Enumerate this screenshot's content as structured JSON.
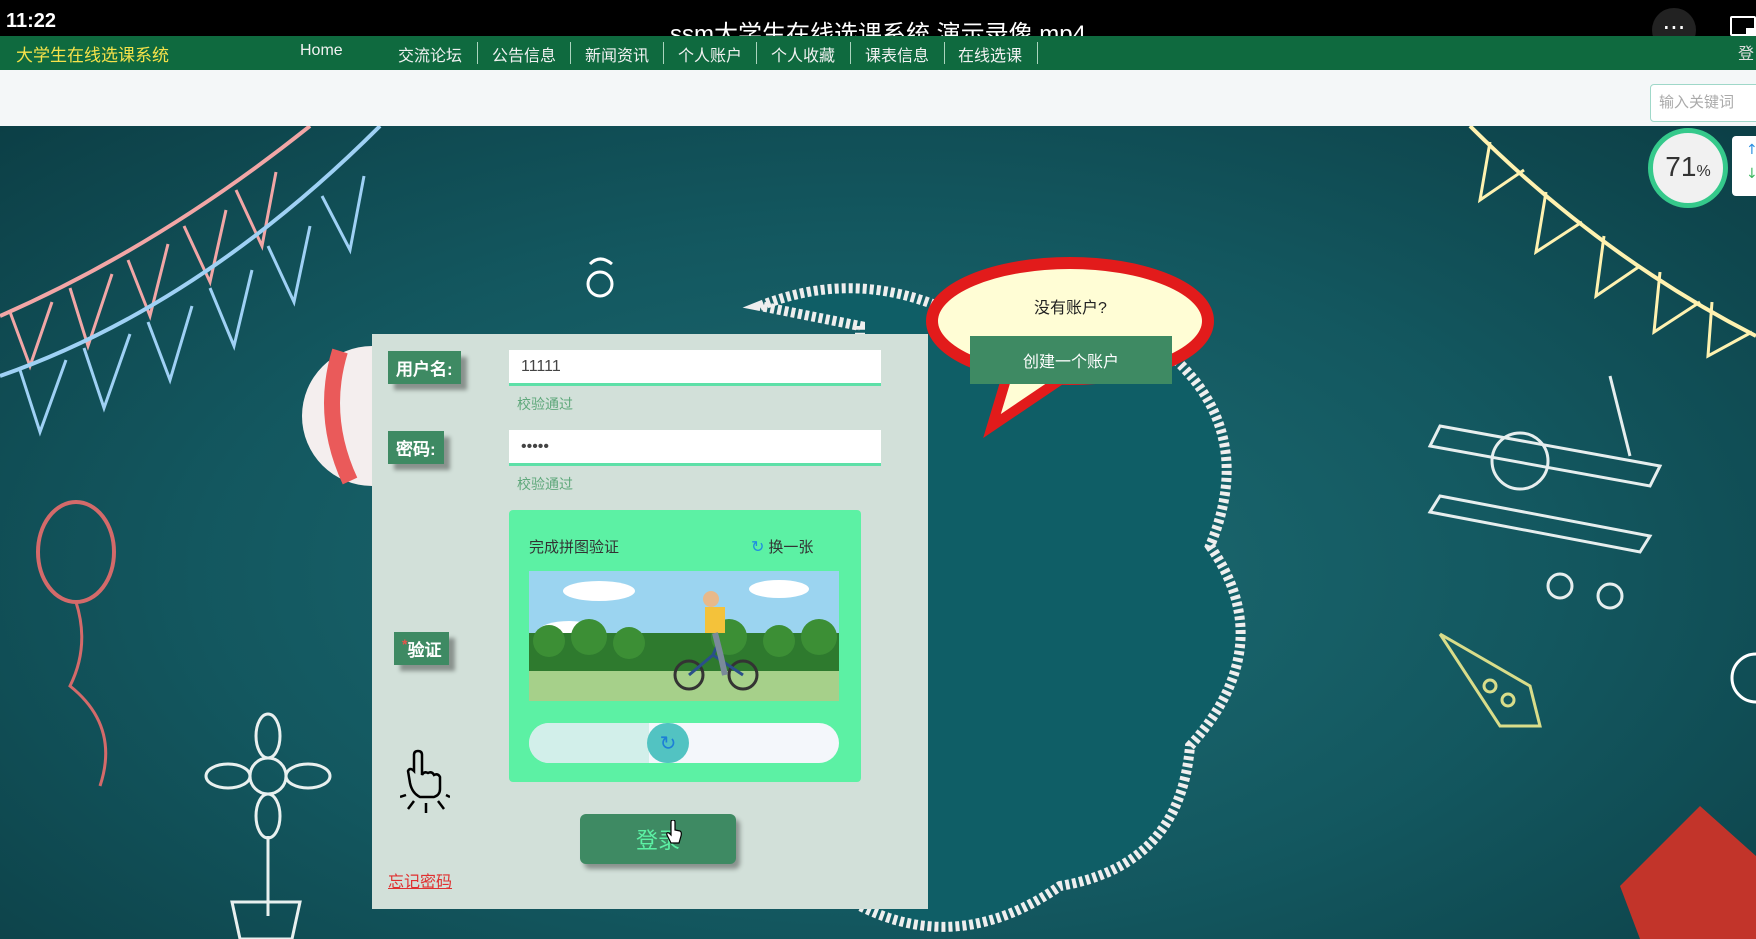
{
  "system": {
    "time": "11:22",
    "video_title": "ssm大学生在线选课系统 演示录像.mp4",
    "more": "···"
  },
  "nav": {
    "brand": "大学生在线选课系统",
    "items": [
      "Home",
      "交流论坛",
      "公告信息",
      "新闻资讯",
      "个人账户",
      "个人收藏",
      "课表信息",
      "在线选课"
    ],
    "corner": "登"
  },
  "search": {
    "placeholder": "输入关键词"
  },
  "network": {
    "percent": "71",
    "percent_sign": "%",
    "up": "↑",
    "down": "↓"
  },
  "signup": {
    "prompt": "没有账户?",
    "button": "创建一个账户"
  },
  "login": {
    "username_label": "用户名:",
    "username_value": "11111",
    "username_hint": "校验通过",
    "password_label": "密码:",
    "password_value": "•••••",
    "password_hint": "校验通过",
    "captcha_label": "验证",
    "captcha_star": "*",
    "captcha_title": "完成拼图验证",
    "captcha_refresh": "换一张",
    "submit": "登录",
    "forgot": "忘记密码"
  },
  "colors": {
    "accent": "#3e8a63",
    "nav_bg": "#0f6a3f",
    "captcha_bg": "#5cf1a4",
    "error": "#e03030"
  }
}
